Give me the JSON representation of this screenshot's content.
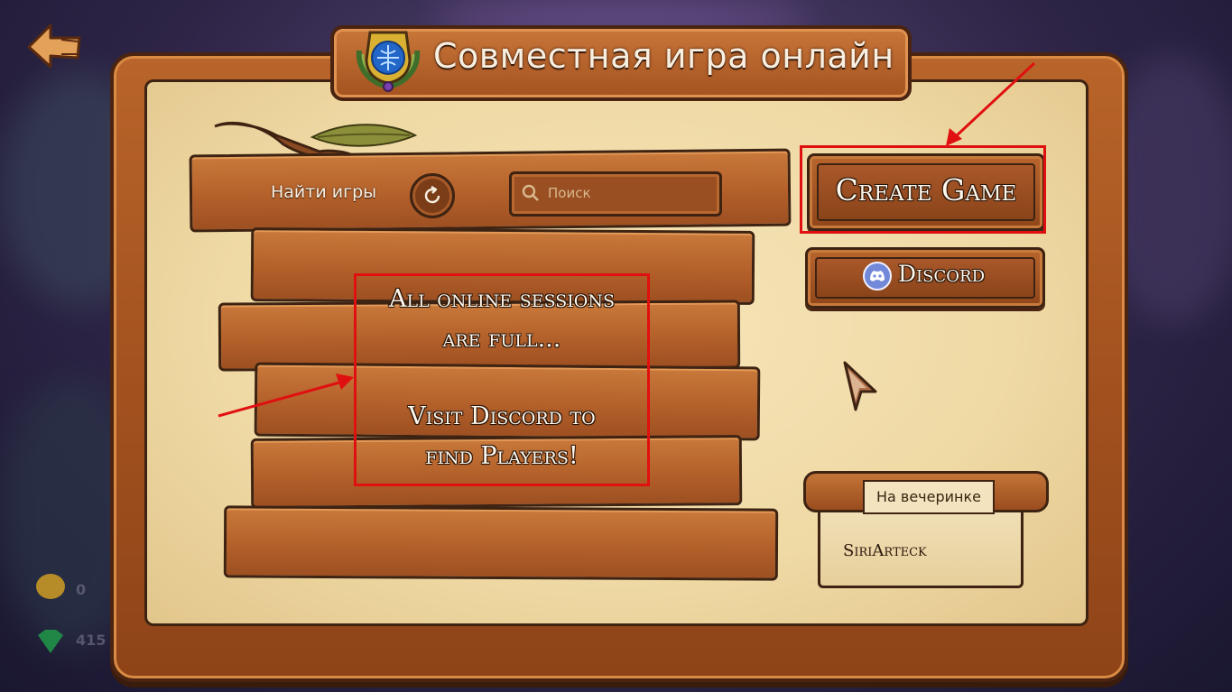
{
  "title": "Совместная игра онлайн",
  "find_games_label": "Найти игры",
  "search": {
    "placeholder": "Поиск"
  },
  "message": {
    "line1": "All online sessions",
    "line2": "are full...",
    "line3": "Visit Discord to",
    "line4": "find Players!"
  },
  "buttons": {
    "create_game": "Create Game",
    "discord": "Discord"
  },
  "party": {
    "label": "На вечеринке",
    "player": "SiriArteck"
  },
  "hud": {
    "gold": "0",
    "gems": "415"
  },
  "colors": {
    "annotation": "#e01010",
    "wood": "#b3602a",
    "parchment": "#efd9a4",
    "discord": "#7289da"
  }
}
